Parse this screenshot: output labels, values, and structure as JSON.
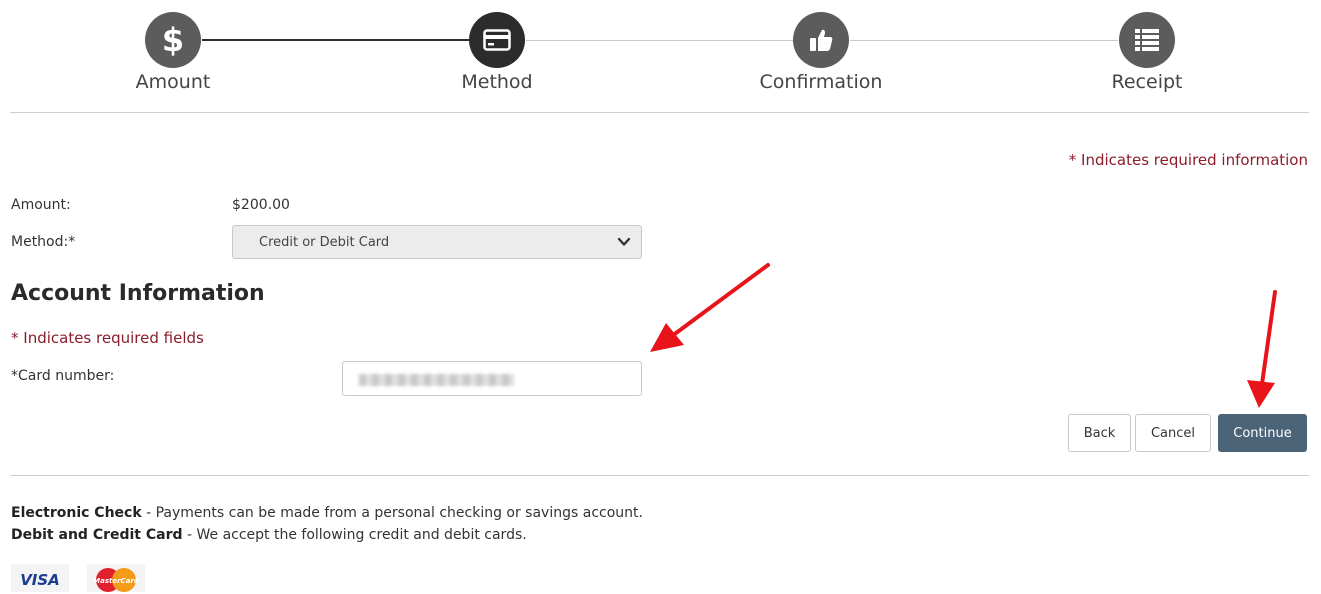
{
  "steps": [
    {
      "label": "Amount",
      "icon": "dollar-icon"
    },
    {
      "label": "Method",
      "icon": "credit-card-icon"
    },
    {
      "label": "Confirmation",
      "icon": "thumbs-up-icon"
    },
    {
      "label": "Receipt",
      "icon": "list-icon"
    }
  ],
  "required_note": "* Indicates required information",
  "form": {
    "amount_label": "Amount:",
    "amount_value": "$200.00",
    "method_label": "Method:*",
    "method_selected": "Credit or Debit Card"
  },
  "account": {
    "title": "Account Information",
    "required_fields_note": "* Indicates required fields",
    "card_number_label": "*Card number:"
  },
  "buttons": {
    "back": "Back",
    "cancel": "Cancel",
    "continue": "Continue"
  },
  "info": {
    "echeck_title": "Electronic Check",
    "echeck_text": " - Payments can be made from a personal checking or savings account.",
    "card_title": "Debit and Credit Card",
    "card_text": " - We accept the following credit and debit cards."
  },
  "cards": {
    "visa": "VISA",
    "mastercard": "MasterCard"
  },
  "colors": {
    "required_red": "#8b1d2c",
    "primary_button": "#4b6478",
    "step_circle": "#5c5c5c",
    "arrow_red": "#e8141a"
  }
}
